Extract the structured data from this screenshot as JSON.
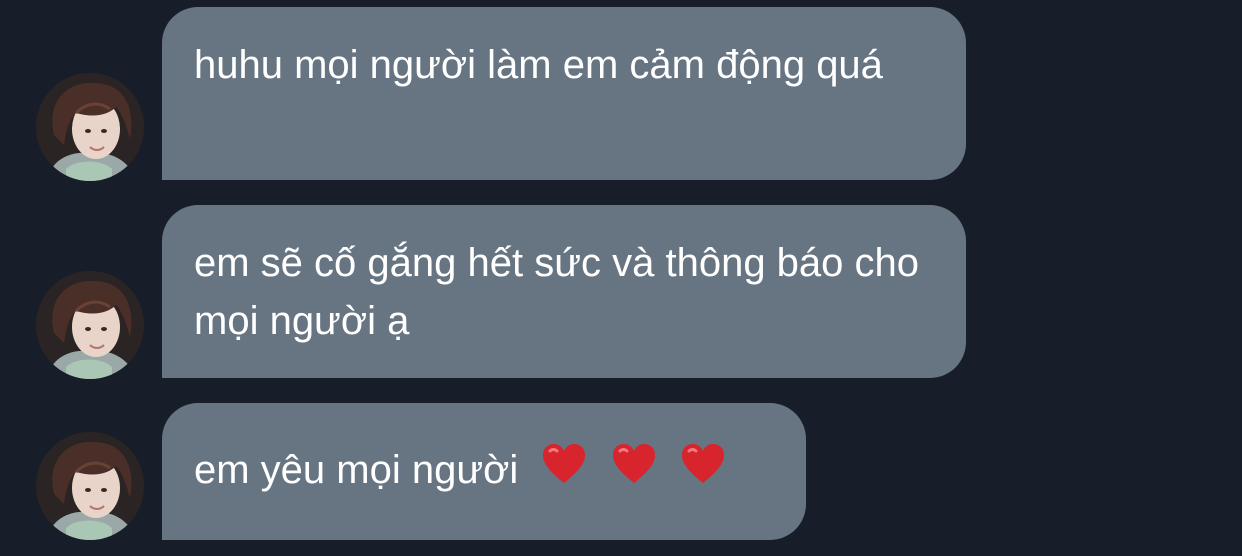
{
  "messages": [
    {
      "text": "huhu mọi người làm em cảm động quá"
    },
    {
      "text": "em sẽ cố gắng hết sức và thông báo cho mọi người ạ"
    },
    {
      "text": "em yêu mọi người",
      "emoji": [
        "heart-emoji",
        "heart-emoji",
        "heart-emoji"
      ]
    }
  ],
  "colors": {
    "background": "#171e29",
    "bubble": "#677482",
    "text": "#ffffff",
    "heart": "#d8242c"
  }
}
